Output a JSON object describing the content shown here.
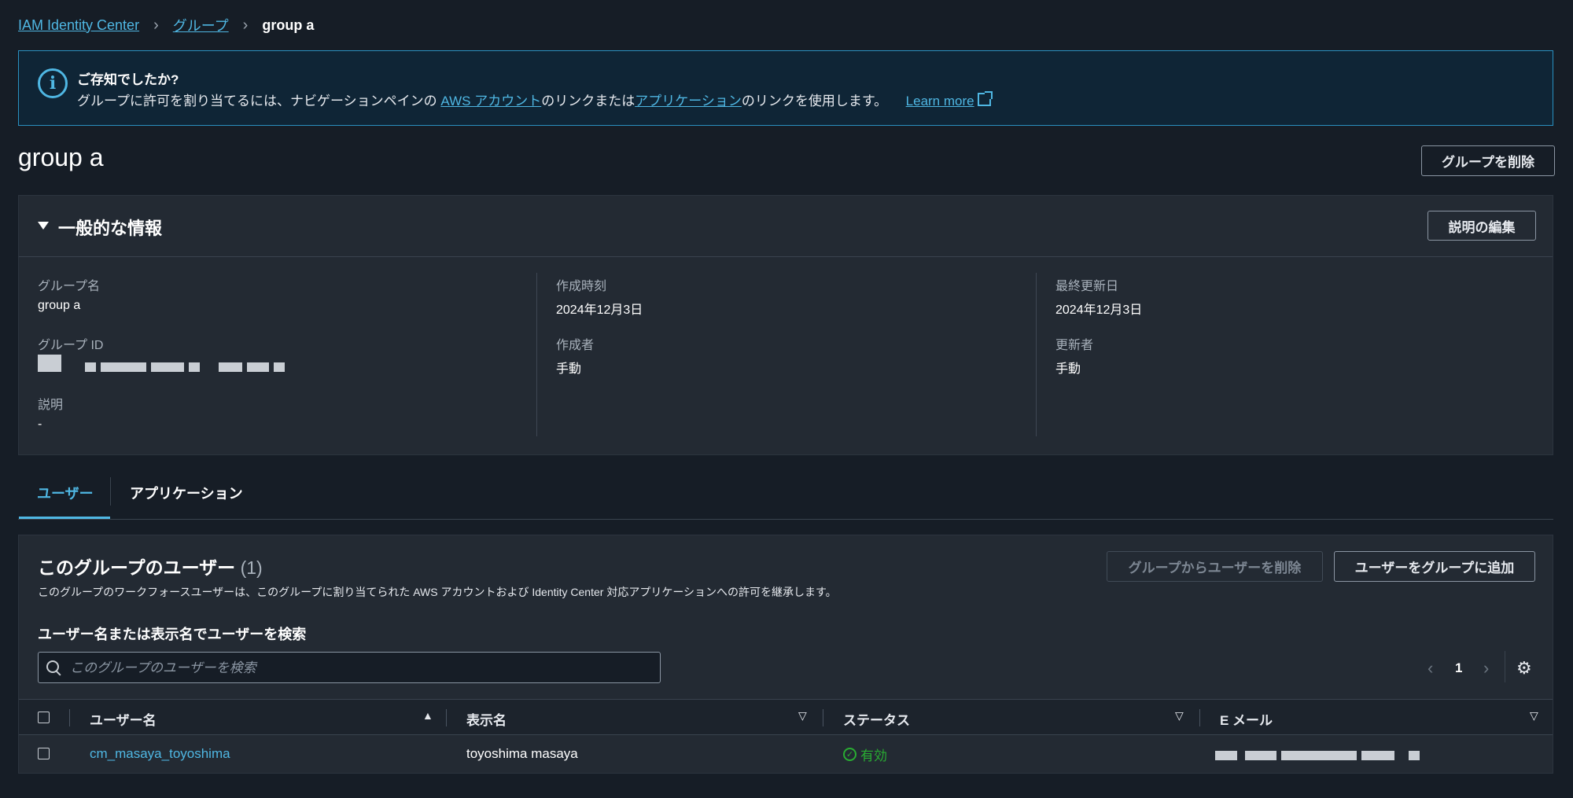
{
  "breadcrumb": {
    "root": "IAM Identity Center",
    "parent": "グループ",
    "current": "group a"
  },
  "banner": {
    "title": "ご存知でしたか?",
    "text_1": "グループに許可を割り当てるには、ナビゲーションペインの ",
    "link_aws": "AWS アカウント",
    "text_2": "のリンクまたは",
    "link_apps": "アプリケーション",
    "text_3": "のリンクを使用します。",
    "learn_more": "Learn more"
  },
  "page": {
    "title": "group a",
    "delete_group_button": "グループを削除"
  },
  "general": {
    "title": "一般的な情報",
    "edit_description_button": "説明の編集",
    "group_name_label": "グループ名",
    "group_name_value": "group a",
    "group_id_label": "グループ ID",
    "description_label": "説明",
    "description_value": "-",
    "created_at_label": "作成時刻",
    "created_at_value": "2024年12月3日",
    "created_by_label": "作成者",
    "created_by_value": "手動",
    "updated_at_label": "最終更新日",
    "updated_at_value": "2024年12月3日",
    "updated_by_label": "更新者",
    "updated_by_value": "手動"
  },
  "tabs": {
    "users": "ユーザー",
    "applications": "アプリケーション"
  },
  "users": {
    "title": "このグループのユーザー",
    "count": "(1)",
    "description": "このグループのワークフォースユーザーは、このグループに割り当てられた AWS アカウントおよび Identity Center 対応アプリケーションへの許可を継承します。",
    "remove_button": "グループからユーザーを削除",
    "add_button": "ユーザーをグループに追加",
    "search_label": "ユーザー名または表示名でユーザーを検索",
    "search_placeholder": "このグループのユーザーを検索",
    "page": "1",
    "columns": {
      "username": "ユーザー名",
      "display_name": "表示名",
      "status": "ステータス",
      "email": "E メール"
    },
    "rows": [
      {
        "username": "cm_masaya_toyoshima",
        "display_name": "toyoshima masaya",
        "status": "有効"
      }
    ]
  },
  "colors": {
    "background": "#161d26",
    "panel": "#232a33",
    "link": "#4fb7e3",
    "status_ok": "#29ad32"
  }
}
